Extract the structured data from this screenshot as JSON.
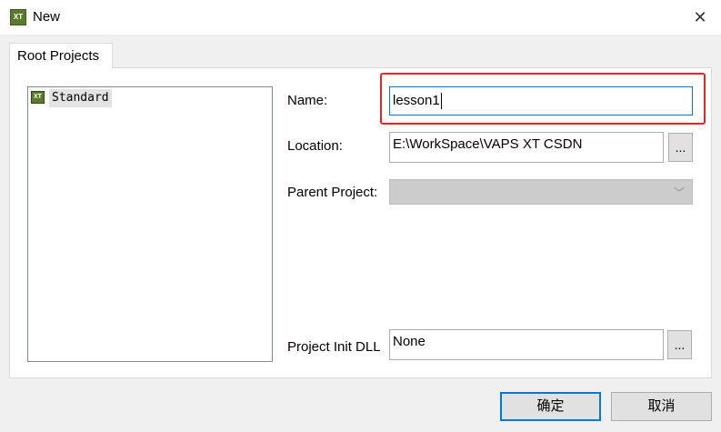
{
  "window": {
    "title": "New",
    "app_icon_text": "XT"
  },
  "tabs": [
    {
      "label": "Root Projects"
    }
  ],
  "tree": {
    "items": [
      {
        "label": "Standard",
        "icon": "xt-template-icon"
      }
    ]
  },
  "form": {
    "name_label": "Name:",
    "name_value": "lesson1",
    "location_label": "Location:",
    "location_value": "E:\\WorkSpace\\VAPS XT CSDN",
    "browse_label": "...",
    "parent_label": "Parent Project:",
    "parent_value": "",
    "init_dll_label": "Project Init DLL",
    "init_dll_value": "None"
  },
  "buttons": {
    "ok": "确定",
    "cancel": "取消"
  },
  "colors": {
    "highlight": "#e32626",
    "focus": "#0078d7",
    "icon_green": "#5a7a2c"
  }
}
